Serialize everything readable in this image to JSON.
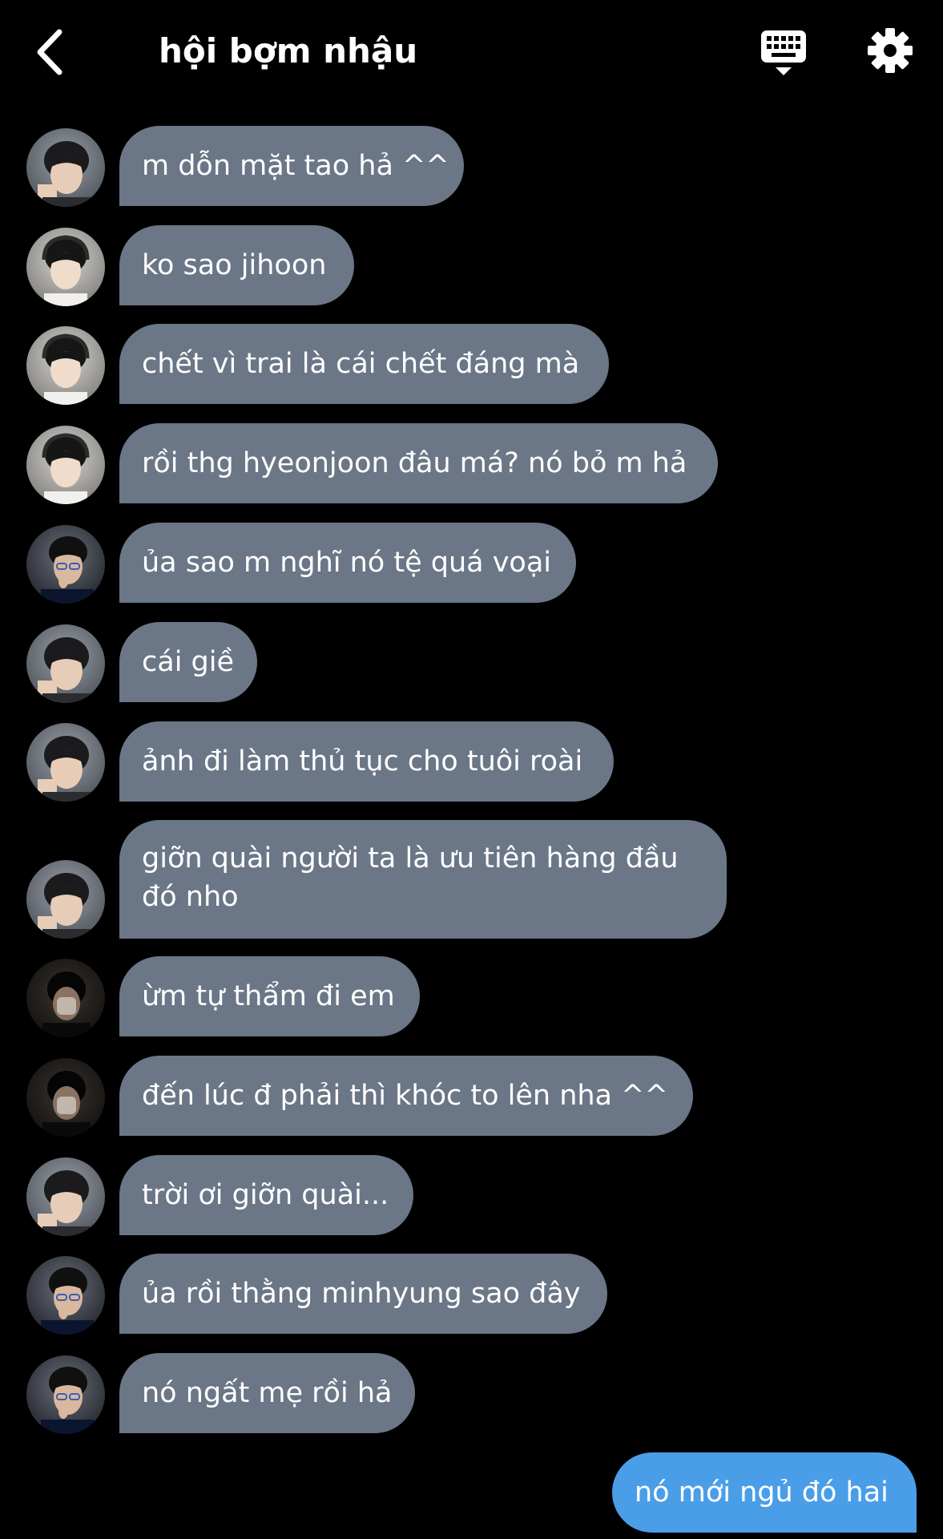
{
  "header": {
    "title": "hội bợm nhậu",
    "back_icon": "chevron-left-icon",
    "keyboard_icon": "keyboard-icon",
    "settings_icon": "gear-icon"
  },
  "colors": {
    "background": "#000000",
    "incoming_bubble": "#6b7686",
    "outgoing_bubble": "#4a9ee8",
    "text": "#ffffff"
  },
  "messages": [
    {
      "sender": "a",
      "text": "m dỗn mặt tao hả ^^"
    },
    {
      "sender": "b",
      "text": "ko sao jihoon"
    },
    {
      "sender": "b",
      "text": "chết vì trai là cái chết đáng mà"
    },
    {
      "sender": "b",
      "text": "rồi thg hyeonjoon đâu má? nó bỏ m hả"
    },
    {
      "sender": "c",
      "text": "ủa sao m nghĩ nó tệ quá voại"
    },
    {
      "sender": "a",
      "text": "cái giề"
    },
    {
      "sender": "a",
      "text": "ảnh đi làm thủ tục cho tuôi roài"
    },
    {
      "sender": "a",
      "text": "giỡn quài người ta là ưu tiên hàng đầu đó nho"
    },
    {
      "sender": "d",
      "text": "ừm tự thẩm đi em"
    },
    {
      "sender": "d",
      "text": "đến lúc đ phải thì khóc to lên nha ^^"
    },
    {
      "sender": "a",
      "text": "trời ơi giỡn quài..."
    },
    {
      "sender": "c",
      "text": "ủa rồi thằng minhyung sao đây"
    },
    {
      "sender": "c",
      "text": "nó ngất mẹ rồi hả"
    },
    {
      "sender": "me",
      "text": "nó mới ngủ đó hai"
    }
  ]
}
